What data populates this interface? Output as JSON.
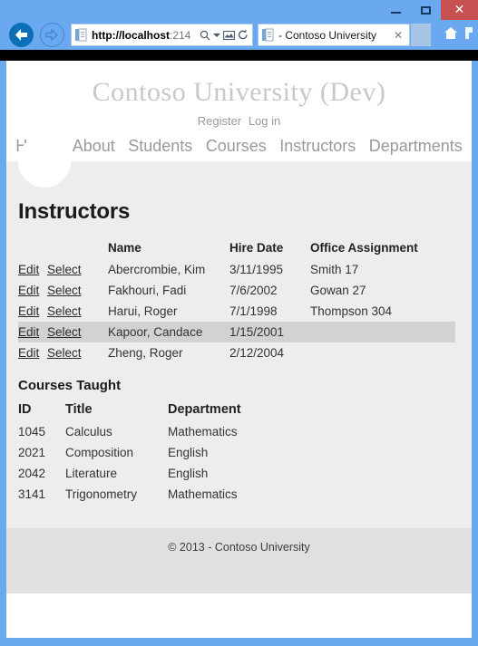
{
  "browser": {
    "window_controls": {
      "minimize_label": "–",
      "maximize_label": "□",
      "close_label": "✕"
    },
    "back_title": "Back",
    "forward_title": "Forward",
    "address": {
      "host": "http://localhost",
      "rest": ":214",
      "full": "http://localhost:214"
    },
    "search_icon_label": "⚲",
    "compat_icon_label": "⛶",
    "refresh_icon_label": "⟳",
    "tab": {
      "title": "- Contoso University",
      "close_label": "✕"
    },
    "home_icon_label": "⌂",
    "tools_icon_label": "⚙"
  },
  "site": {
    "brand": "Contoso University (Dev)",
    "auth": {
      "register": "Register",
      "login": "Log in"
    },
    "nav": [
      {
        "label": "Home"
      },
      {
        "label": "About"
      },
      {
        "label": "Students"
      },
      {
        "label": "Courses"
      },
      {
        "label": "Instructors"
      },
      {
        "label": "Departments"
      }
    ],
    "footer": "© 2013 - Contoso University"
  },
  "page": {
    "title": "Instructors",
    "instructors_table": {
      "headers": [
        "",
        "",
        "Name",
        "Hire Date",
        "Office Assignment"
      ],
      "rows": [
        {
          "edit": "Edit",
          "select": "Select",
          "name": "Abercrombie, Kim",
          "hire_date": "3/11/1995",
          "office": "Smith 17",
          "selected": false
        },
        {
          "edit": "Edit",
          "select": "Select",
          "name": "Fakhouri, Fadi",
          "hire_date": "7/6/2002",
          "office": "Gowan 27",
          "selected": false
        },
        {
          "edit": "Edit",
          "select": "Select",
          "name": "Harui, Roger",
          "hire_date": "7/1/1998",
          "office": "Thompson 304",
          "selected": false
        },
        {
          "edit": "Edit",
          "select": "Select",
          "name": "Kapoor, Candace",
          "hire_date": "1/15/2001",
          "office": "",
          "selected": true
        },
        {
          "edit": "Edit",
          "select": "Select",
          "name": "Zheng, Roger",
          "hire_date": "2/12/2004",
          "office": "",
          "selected": false
        }
      ]
    },
    "courses_section": {
      "title": "Courses Taught",
      "headers": [
        "ID",
        "Title",
        "Department"
      ],
      "rows": [
        {
          "id": "1045",
          "title": "Calculus",
          "department": "Mathematics"
        },
        {
          "id": "2021",
          "title": "Composition",
          "department": "English"
        },
        {
          "id": "2042",
          "title": "Literature",
          "department": "English"
        },
        {
          "id": "3141",
          "title": "Trigonometry",
          "department": "Mathematics"
        }
      ]
    }
  },
  "colors": {
    "window_frame": "#6aa9f0",
    "back_button": "#0d6fb8",
    "close_button": "#c75050",
    "page_background": "#ededed",
    "selected_row": "#d2d2d2",
    "footer_background": "#e0e0e0",
    "brand_text": "#c8c8c8"
  }
}
